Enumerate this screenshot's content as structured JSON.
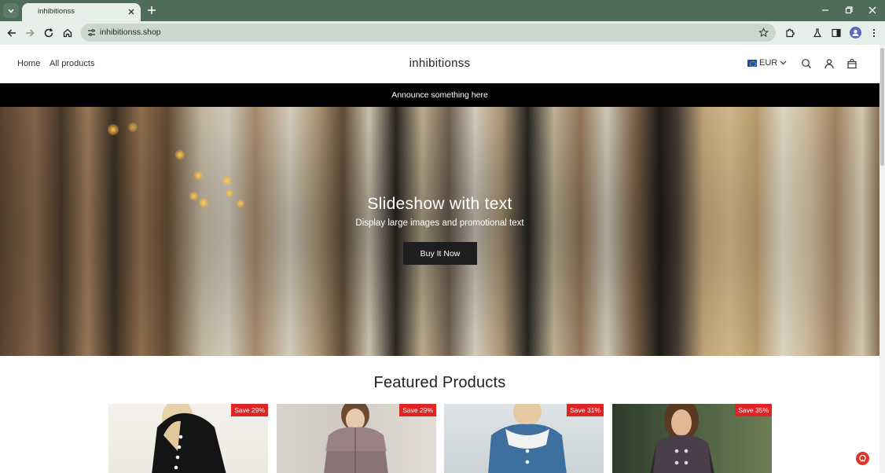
{
  "browser": {
    "tab_title": "inhibitionss",
    "url": "inhibitionss.shop"
  },
  "header": {
    "nav": [
      {
        "label": "Home"
      },
      {
        "label": "All products"
      }
    ],
    "logo": "inhibitionss",
    "currency": "EUR"
  },
  "announcement": "Announce something here",
  "hero": {
    "title": "Slideshow with text",
    "subtitle": "Display large images and promotional text",
    "button": "Buy It Now"
  },
  "featured": {
    "title": "Featured Products",
    "products": [
      {
        "badge": "Save 29%"
      },
      {
        "badge": "Save 29%"
      },
      {
        "badge": "Save 31%"
      },
      {
        "badge": "Save 35%"
      }
    ]
  },
  "colors": {
    "browser_frame": "#4f6b5a",
    "announcement_bg": "#000000",
    "sale_badge": "#e02424",
    "hero_button": "#1e1e1e"
  }
}
